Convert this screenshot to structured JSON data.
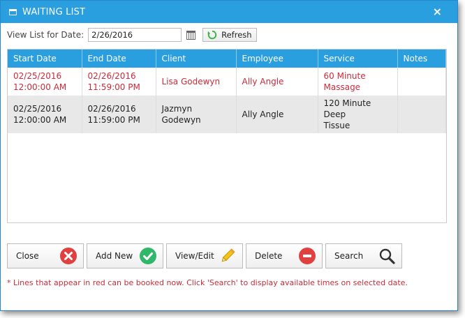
{
  "window": {
    "title": "WAITING LIST",
    "close_glyph": "×"
  },
  "date_filter": {
    "label": "View List for Date:",
    "value": "2/26/2016",
    "refresh_label": "Refresh"
  },
  "table": {
    "columns": [
      "Start Date",
      "End Date",
      "Client",
      "Employee",
      "Service",
      "Notes"
    ],
    "rows": [
      {
        "start": [
          "02/25/2016",
          "12:00:00 AM"
        ],
        "end": [
          "02/26/2016",
          "11:59:00 PM"
        ],
        "client": "Lisa Godewyn",
        "employee": "Ally Angle",
        "service": [
          "60 Minute",
          "Massage"
        ],
        "notes": "",
        "bookable": true
      },
      {
        "start": [
          "02/25/2016",
          "12:00:00 AM"
        ],
        "end": [
          "02/26/2016",
          "11:59:00 PM"
        ],
        "client": "Jazmyn Godewyn",
        "employee": "Ally Angle",
        "service": [
          "120 Minute Deep",
          "Tissue"
        ],
        "notes": "",
        "bookable": false
      }
    ]
  },
  "actions": {
    "close": "Close",
    "add_new": "Add New",
    "view_edit": "View/Edit",
    "delete": "Delete",
    "search": "Search"
  },
  "footnote": "* Lines that appear in red can be booked now. Click 'Search' to display available times on selected date.",
  "colors": {
    "accent": "#2a9fe0",
    "bookable_text": "#cc2a3a",
    "close_icon": "#e04040",
    "add_icon": "#2fb76a",
    "delete_icon": "#e04040"
  }
}
